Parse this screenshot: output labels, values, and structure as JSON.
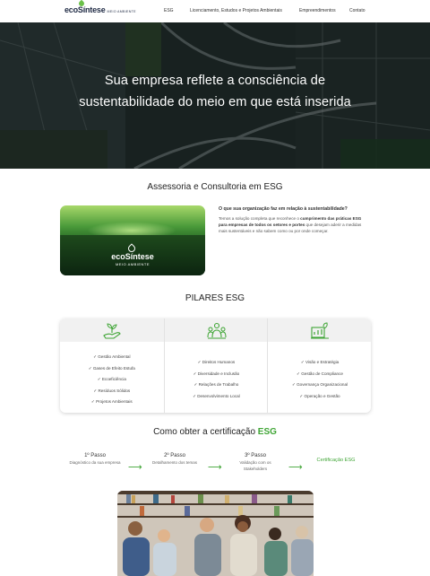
{
  "nav": {
    "logo": "ecoSíntese",
    "logo_sub": "MEIO AMBIENTE",
    "links": [
      "ESG",
      "Licenciamento, Estudos e Projetos Ambientais",
      "Empreendimentos",
      "Contato"
    ]
  },
  "hero": {
    "title_line1": "Sua empresa reflete a consciência de",
    "title_line2": "sustentabilidade do meio em que está inserida"
  },
  "assessoria": {
    "title": "Assessoria e Consultoria em ESG",
    "banner_logo": "ecoSíntese",
    "banner_sub": "MEIO AMBIENTE",
    "question": "O que sua organização faz em relação à sustentabilidade?",
    "body_part1": "Temos a solução completa que reconhece o ",
    "body_bold": "cumprimento das práticas ESG para empresas de todos os setores e portes",
    "body_part2": " que desejam aderir a medidas mais sustentáveis e não sabem como ou por onde começar."
  },
  "pilares": {
    "title": "PILARES ESG",
    "columns": [
      {
        "icon": "hand-plant-icon",
        "items": [
          "Gestão Ambiental",
          "Gases de Efeito Estufa",
          "Ecoeficiência",
          "Resíduos Sólidos",
          "Projetos Ambientais"
        ]
      },
      {
        "icon": "people-group-icon",
        "items": [
          "Direitos Humanos",
          "Diversidade e Inclusão",
          "Relações de Trabalho",
          "Desenvolvimento Local"
        ]
      },
      {
        "icon": "governance-chart-icon",
        "items": [
          "Visão e Estratégia",
          "Gestão de Compliance",
          "Governança Organizacional",
          "Operação e Gestão"
        ]
      }
    ]
  },
  "certificacao": {
    "title_prefix": "Como obter a certificação ",
    "title_accent": "ESG",
    "steps": [
      {
        "title": "1º Passo",
        "desc": "Diagnóstico da sua empresa"
      },
      {
        "title": "2º Passo",
        "desc": "Detalhamento dos temas"
      },
      {
        "title": "3º Passo",
        "desc": "Validação com os Stakeholders"
      }
    ],
    "final": "Certificação ESG",
    "accent_color": "#3fa535"
  }
}
